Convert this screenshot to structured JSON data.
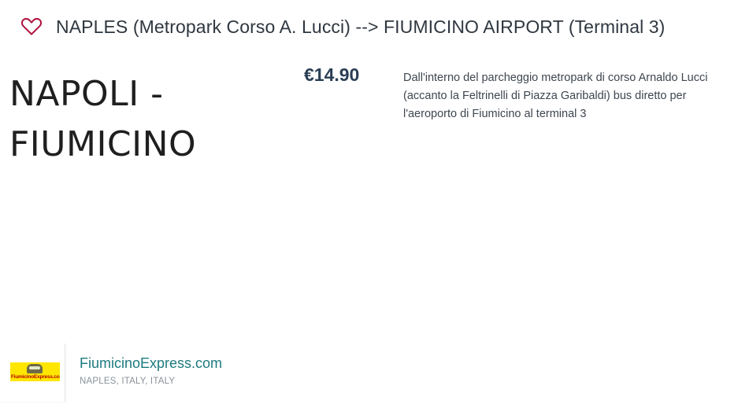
{
  "product": {
    "favorite_icon": "heart-outline-icon",
    "title": "NAPLES (Metropark Corso A. Lucci) --> FIUMICINO AIRPORT (Terminal 3)",
    "cover_line1": "NAPOLI -",
    "cover_line2": "FIUMICINO",
    "price": "€14.90",
    "description": "Dall'interno del parcheggio metropark di corso Arnaldo Lucci (accanto la Feltrinelli di Piazza Garibaldi) bus diretto per l'aeroporto di Fiumicino al terminal 3"
  },
  "vendor": {
    "logo_text": "FiumicinoExpress.com",
    "name": "FiumicinoExpress.com",
    "location": "NAPLES, ITALY, ITALY"
  },
  "colors": {
    "heart": "#b0123e",
    "title": "#2f3740",
    "price": "#2a3e54",
    "vendor_link": "#1d7a7e",
    "logo_bg": "#ffe600"
  }
}
